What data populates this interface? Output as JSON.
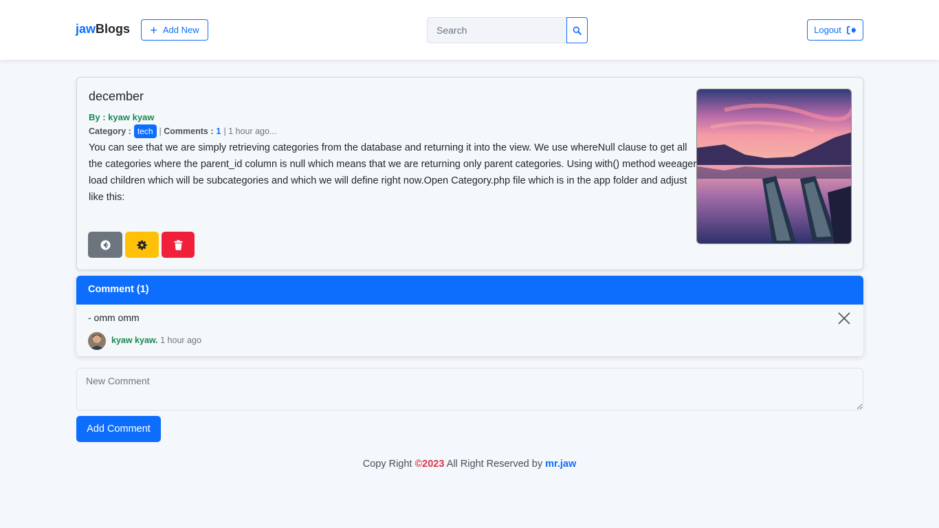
{
  "brand": {
    "accent": "jaw",
    "rest": "Blogs"
  },
  "nav": {
    "add_new_label": "Add New",
    "search_placeholder": "Search",
    "logout_label": "Logout"
  },
  "post": {
    "title": "december",
    "author_prefix": "By : ",
    "author": "kyaw kyaw",
    "category_label": "Category :",
    "category": "tech",
    "comments_label": "Comments :",
    "comments_count": "1",
    "time_ago": "1 hour ago...",
    "body": "You can see that we are simply retrieving categories from the database and returning it into the view. We use whereNull clause to get all the categories where the parent_id column is null which means that we are returning only parent categories. Using with() method weeager load children which will be subcategories and which we will define right now.Open Category.php file which is in the app folder and adjust like this:",
    "action_icons": [
      "arrow-left-circle-icon",
      "gear-icon",
      "trash-icon"
    ]
  },
  "comments": {
    "header": "Comment (1)",
    "items": [
      {
        "text": "- omm omm",
        "author": "kyaw kyaw.",
        "time": "1 hour ago"
      }
    ]
  },
  "new_comment": {
    "placeholder": "New Comment",
    "button_label": "Add Comment"
  },
  "footer": {
    "prefix": "Copy Right ",
    "year": "©2023",
    "middle": " All Right Reserved by ",
    "author": "mr.jaw"
  },
  "colors": {
    "primary": "#0d6efd",
    "success": "#198754",
    "warning": "#ffc107",
    "danger": "#f0203a",
    "secondary": "#6c757d"
  }
}
